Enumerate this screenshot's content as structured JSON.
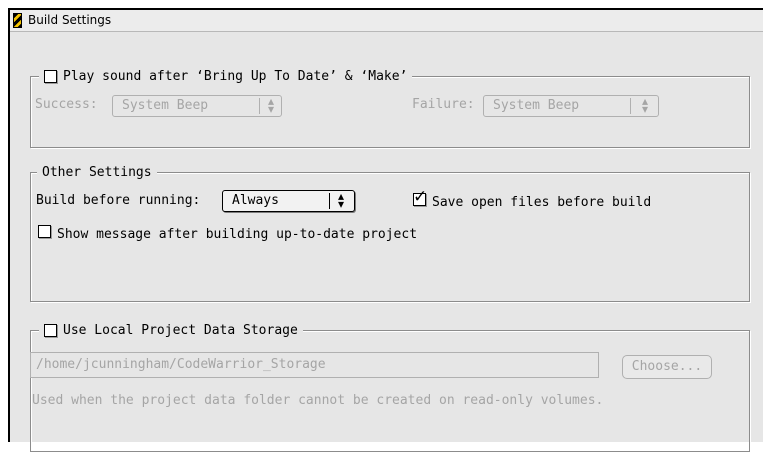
{
  "window": {
    "title": "Build Settings",
    "icon": "codewarrior-icon"
  },
  "sound_group": {
    "checkbox_label": "Play sound after ‘Bring Up To Date’ & ‘Make’",
    "checked": false,
    "success_label": "Success:",
    "success_value": "System Beep",
    "failure_label": "Failure:",
    "failure_value": "System Beep"
  },
  "other_group": {
    "legend": "Other Settings",
    "build_label": "Build before running:",
    "build_value": "Always",
    "save_label": "Save open files before build",
    "save_checked": true,
    "show_message_label": "Show message after building up-to-date project",
    "show_message_checked": false
  },
  "storage_group": {
    "checkbox_label": "Use Local Project Data Storage",
    "checked": false,
    "path": "/home/jcunningham/CodeWarrior_Storage",
    "choose_label": "Choose...",
    "note": "Used when the project data folder cannot be created on read-only volumes."
  }
}
